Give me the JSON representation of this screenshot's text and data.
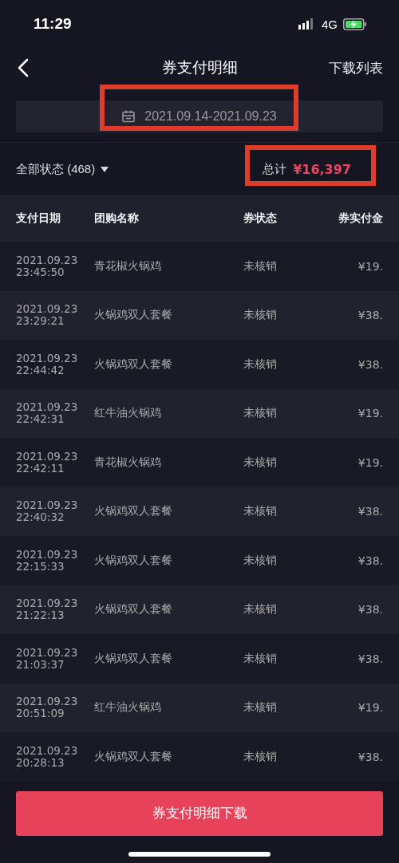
{
  "status_bar": {
    "time": "11:29",
    "network": "4G"
  },
  "nav": {
    "title": "券支付明细",
    "action": "下载列表"
  },
  "date_range": "2021.09.14-2021.09.23",
  "filter": {
    "label": "全部状态 (468)"
  },
  "total": {
    "label": "总计",
    "amount": "¥16,397"
  },
  "table": {
    "columns": [
      "支付日期",
      "团购名称",
      "券状态",
      "券实付金"
    ],
    "rows": [
      {
        "date": "2021.09.23",
        "time": "23:45:50",
        "name": "青花椒火锅鸡",
        "status": "未核销",
        "amount": "¥19."
      },
      {
        "date": "2021.09.23",
        "time": "23:29:21",
        "name": "火锅鸡双人套餐",
        "status": "未核销",
        "amount": "¥38."
      },
      {
        "date": "2021.09.23",
        "time": "22:44:42",
        "name": "火锅鸡双人套餐",
        "status": "未核销",
        "amount": "¥38."
      },
      {
        "date": "2021.09.23",
        "time": "22:42:31",
        "name": "红牛油火锅鸡",
        "status": "未核销",
        "amount": "¥19."
      },
      {
        "date": "2021.09.23",
        "time": "22:42:11",
        "name": "青花椒火锅鸡",
        "status": "未核销",
        "amount": "¥19."
      },
      {
        "date": "2021.09.23",
        "time": "22:40:32",
        "name": "火锅鸡双人套餐",
        "status": "未核销",
        "amount": "¥38."
      },
      {
        "date": "2021.09.23",
        "time": "22:15:33",
        "name": "火锅鸡双人套餐",
        "status": "未核销",
        "amount": "¥38."
      },
      {
        "date": "2021.09.23",
        "time": "21:22:13",
        "name": "火锅鸡双人套餐",
        "status": "未核销",
        "amount": "¥38."
      },
      {
        "date": "2021.09.23",
        "time": "21:03:37",
        "name": "火锅鸡双人套餐",
        "status": "未核销",
        "amount": "¥38."
      },
      {
        "date": "2021.09.23",
        "time": "20:51:09",
        "name": "红牛油火锅鸡",
        "status": "未核销",
        "amount": "¥19."
      },
      {
        "date": "2021.09.23",
        "time": "20:28:13",
        "name": "火锅鸡双人套餐",
        "status": "未核销",
        "amount": "¥38."
      }
    ]
  },
  "download_button": "券支付明细下载"
}
